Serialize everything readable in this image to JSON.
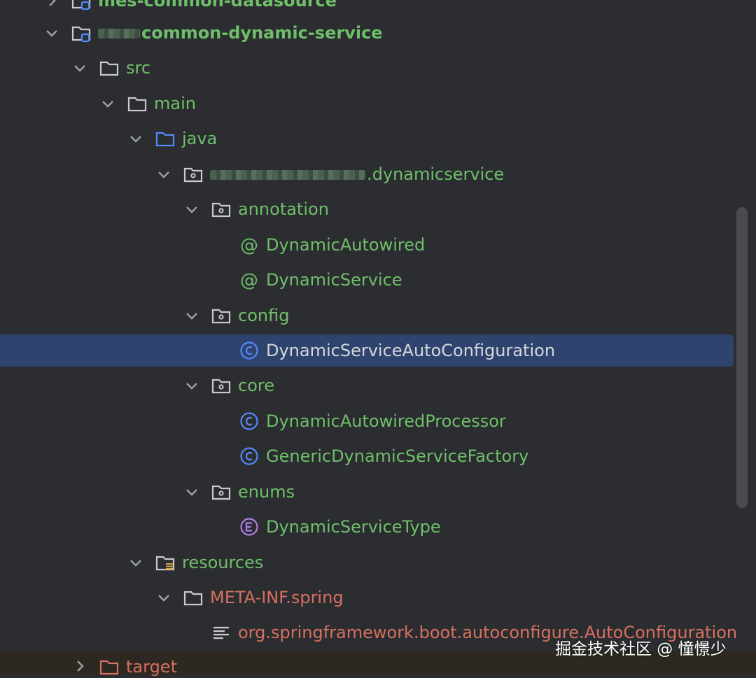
{
  "tree": {
    "top_module": "mes-common-datasource",
    "module": "common-dynamic-service",
    "src": "src",
    "main": "main",
    "java": "java",
    "package_suffix": ".dynamicservice",
    "annotation": "annotation",
    "dynamic_autowired": "DynamicAutowired",
    "dynamic_service": "DynamicService",
    "config": "config",
    "auto_config": "DynamicServiceAutoConfiguration",
    "core": "core",
    "processor": "DynamicAutowiredProcessor",
    "factory": "GenericDynamicServiceFactory",
    "enums": "enums",
    "service_type": "DynamicServiceType",
    "resources": "resources",
    "meta_inf": "META-INF.spring",
    "imports_file": "org.springframework.boot.autoconfigure.AutoConfiguration",
    "target": "target"
  },
  "watermark": "掘金技术社区 @ 憧憬少",
  "colors": {
    "background": "#2b2d30",
    "selection": "#2e436e",
    "green_text": "#6fbf6a",
    "red_text": "#d7705f",
    "class_icon": "#548af7",
    "enum_icon": "#b07de8"
  }
}
